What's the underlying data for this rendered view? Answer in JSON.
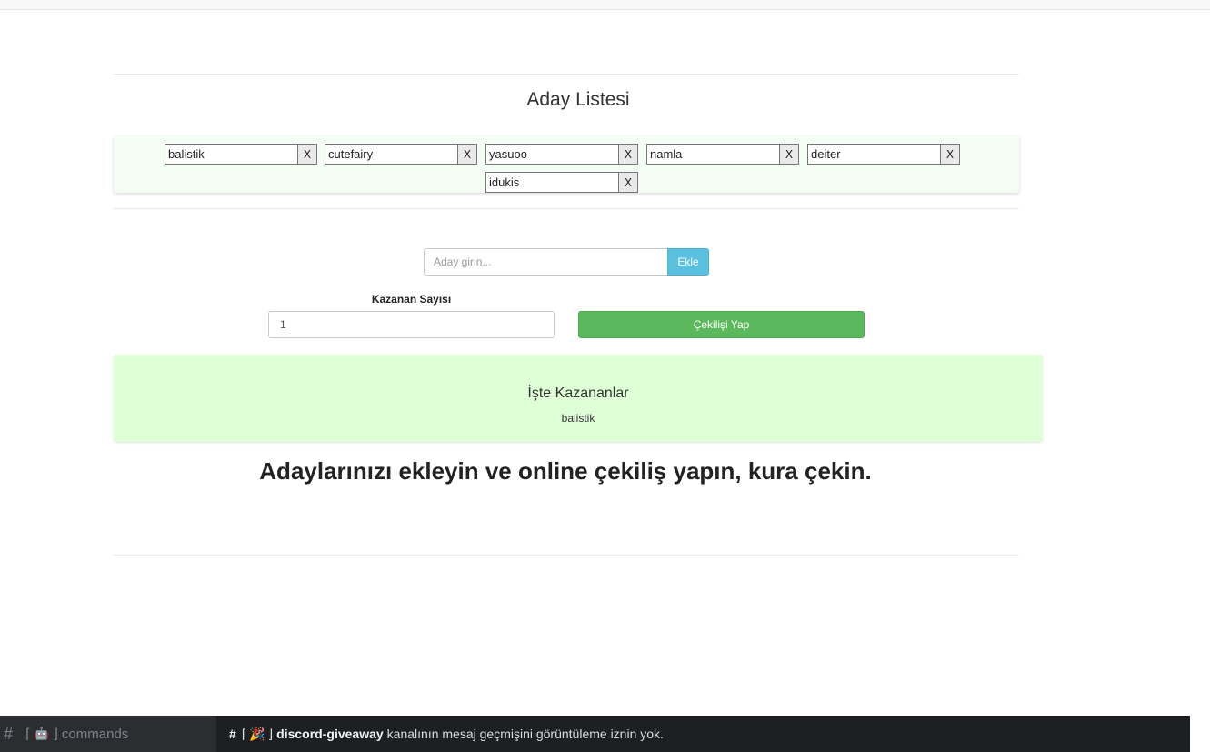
{
  "list_title": "Aday Listesi",
  "candidates": [
    {
      "name": "balistik",
      "remove": "X"
    },
    {
      "name": "cutefairy",
      "remove": "X"
    },
    {
      "name": "yasuoo",
      "remove": "X"
    },
    {
      "name": "namla",
      "remove": "X"
    },
    {
      "name": "deiter",
      "remove": "X"
    },
    {
      "name": "idukis",
      "remove": "X"
    }
  ],
  "add": {
    "placeholder": "Aday girin...",
    "button": "Ekle"
  },
  "winner_count": {
    "label": "Kazanan Sayısı",
    "value": "1"
  },
  "draw_button": "Çekilişi Yap",
  "winners": {
    "title": "İşte Kazananlar",
    "names": "balistik"
  },
  "headline": "Adaylarınızı ekleyin ve online çekiliş yapın, kura çekin.",
  "taskbar": {
    "left_hash": "#",
    "left_bracket_open": "⌈",
    "left_bracket_close": "⌋",
    "left_channel": "commands",
    "right_hash": "#",
    "right_bracket_open": "⌈",
    "right_bracket_close": "⌋",
    "right_channel": "discord-giveaway",
    "message": "kanalının mesaj geçmişini görüntüleme iznin yok."
  },
  "colors": {
    "ekle": "#5bc0de",
    "draw": "#5cb85c",
    "winners_bg": "#dfffd6",
    "candidates_bg": "#f3fdf3"
  }
}
